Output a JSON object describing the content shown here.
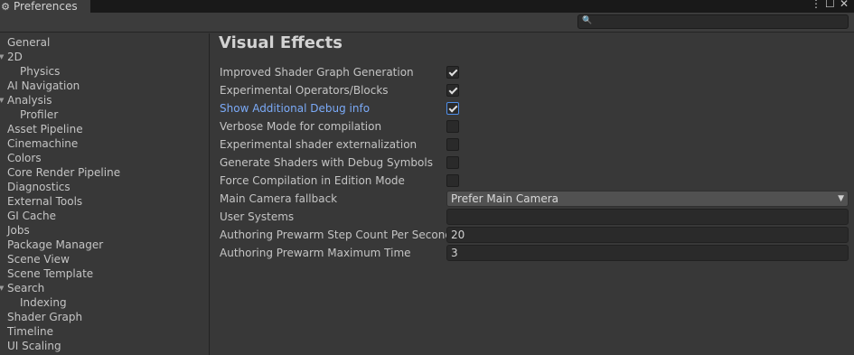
{
  "window": {
    "tab_title": "Preferences",
    "controls": {
      "more": "⋮",
      "maximize": "☐",
      "close": "✕"
    }
  },
  "search": {
    "placeholder": "",
    "value": "",
    "icon": "search-icon"
  },
  "sidebar": {
    "items": [
      {
        "label": "General"
      },
      {
        "label": "2D"
      },
      {
        "label": "Physics"
      },
      {
        "label": "AI Navigation"
      },
      {
        "label": "Analysis"
      },
      {
        "label": "Profiler"
      },
      {
        "label": "Asset Pipeline"
      },
      {
        "label": "Cinemachine"
      },
      {
        "label": "Colors"
      },
      {
        "label": "Core Render Pipeline"
      },
      {
        "label": "Diagnostics"
      },
      {
        "label": "External Tools"
      },
      {
        "label": "GI Cache"
      },
      {
        "label": "Jobs"
      },
      {
        "label": "Package Manager"
      },
      {
        "label": "Scene View"
      },
      {
        "label": "Scene Template"
      },
      {
        "label": "Search"
      },
      {
        "label": "Indexing"
      },
      {
        "label": "Shader Graph"
      },
      {
        "label": "Timeline"
      },
      {
        "label": "UI Scaling"
      }
    ]
  },
  "main": {
    "title": "Visual Effects",
    "settings": [
      {
        "label": "Improved Shader Graph Generation",
        "checked": true
      },
      {
        "label": "Experimental Operators/Blocks",
        "checked": true
      },
      {
        "label": "Show Additional Debug info",
        "checked": true
      },
      {
        "label": "Verbose Mode for compilation",
        "checked": false
      },
      {
        "label": "Experimental shader externalization",
        "checked": false
      },
      {
        "label": "Generate Shaders with Debug Symbols",
        "checked": false
      },
      {
        "label": "Force Compilation in Edition Mode",
        "checked": false
      },
      {
        "label": "Main Camera fallback",
        "value": "Prefer Main Camera"
      },
      {
        "label": "User Systems",
        "value": ""
      },
      {
        "label": "Authoring Prewarm Step Count Per Second",
        "value": "20"
      },
      {
        "label": "Authoring Prewarm Maximum Time",
        "value": "3"
      }
    ]
  },
  "colors": {
    "accent": "#7baaf7",
    "background": "#383838",
    "text": "#c4c4c4"
  }
}
